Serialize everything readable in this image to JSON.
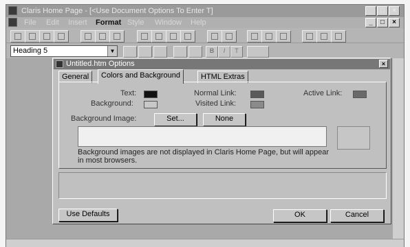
{
  "app": {
    "title": "Claris Home Page - [<Use Document Options To Enter T]",
    "menus": [
      "File",
      "Edit",
      "Insert",
      "Format",
      "Style",
      "Window",
      "Help"
    ],
    "window_buttons": [
      "_",
      "□",
      "×"
    ],
    "doc_window_buttons": [
      "_",
      "□",
      "×"
    ]
  },
  "toolbar": {
    "style_select_value": "Heading 5",
    "format_buttons": [
      "B",
      "I",
      "T"
    ]
  },
  "dialog": {
    "title": "Untitled.htm Options",
    "close_label": "×",
    "tabs": [
      "General",
      "Colors and Background",
      "HTML Extras"
    ],
    "active_tab": "Colors and Background",
    "colors": {
      "text_label": "Text:",
      "background_label": "Background:",
      "normal_link_label": "Normal Link:",
      "visited_link_label": "Visited Link:",
      "active_link_label": "Active Link:",
      "text_color": "#111111",
      "background_color": "#c8c8c8",
      "normal_link_color": "#5a5a5a",
      "visited_link_color": "#8a8a8a",
      "active_link_color": "#6a6a6a"
    },
    "background_image_label": "Background Image:",
    "set_button": "Set...",
    "none_button": "None",
    "note": "Background images are not displayed in Claris Home Page, but will appear in most browsers.",
    "use_defaults_button": "Use Defaults",
    "ok_button": "OK",
    "cancel_button": "Cancel"
  }
}
